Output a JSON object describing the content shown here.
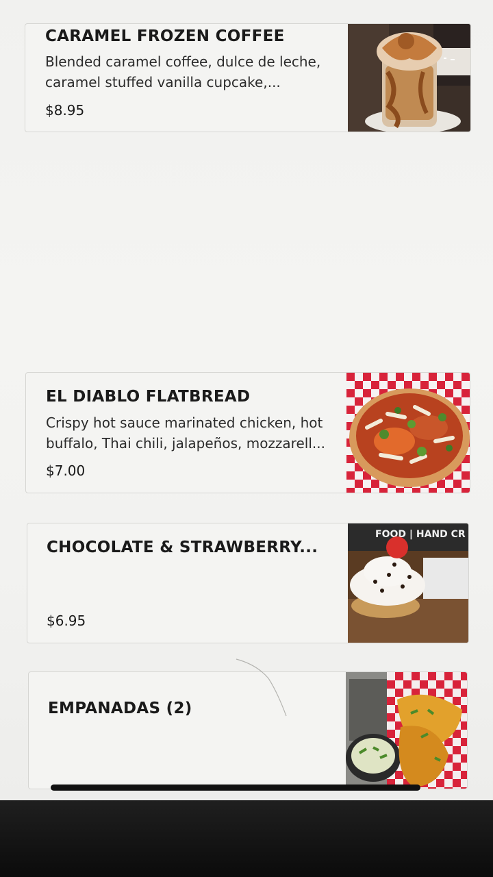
{
  "menu_items": [
    {
      "title": "CARAMEL FROZEN COFFEE",
      "description": "Blended caramel coffee, dulce de leche, caramel stuffed vanilla cupcake,...",
      "price": "$8.95",
      "image_icon": "frozen-coffee-photo"
    },
    {
      "title": "EL DIABLO FLATBREAD",
      "description": "Crispy hot sauce marinated chicken, hot buffalo, Thai chili, jalapeños, mozzarell...",
      "price": "$7.00",
      "image_icon": "flatbread-photo"
    },
    {
      "title": "CHOCOLATE & STRAWBERRY...",
      "description": "",
      "price": "$6.95",
      "image_icon": "sundae-photo"
    },
    {
      "title": "EMPANADAS (2)",
      "description": "",
      "price": "",
      "image_icon": "empanadas-photo"
    }
  ],
  "colors": {
    "card_background": "#f4f4f2",
    "card_border": "#d6d6d3",
    "text": "#1a1a1a",
    "bezel": "#111111"
  }
}
